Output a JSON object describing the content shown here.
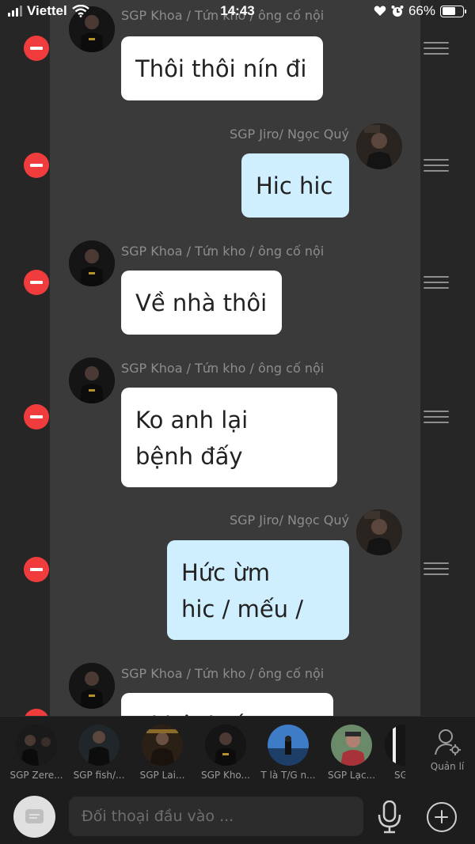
{
  "status_bar": {
    "carrier": "Viettel",
    "time": "14:43",
    "battery_percent": "66%",
    "battery_level": 0.66,
    "icons": [
      "signal-icon",
      "wifi-icon",
      "heart-icon",
      "alarm-icon",
      "battery-icon"
    ]
  },
  "messages": [
    {
      "sender": "SGP Khoa / Tứn kho / ông cố nội",
      "lines": [
        "Thôi thôi nín đi"
      ],
      "direction": "incoming"
    },
    {
      "sender": "SGP Jiro/ Ngọc Quý",
      "lines": [
        "Hic hic"
      ],
      "direction": "outgoing"
    },
    {
      "sender": "SGP Khoa / Tứn kho / ông cố nội",
      "lines": [
        "Về nhà thôi"
      ],
      "direction": "incoming"
    },
    {
      "sender": "SGP Khoa / Tứn kho / ông cố nội",
      "lines": [
        "Ko anh lại",
        "bệnh đấy"
      ],
      "direction": "incoming"
    },
    {
      "sender": "SGP Jiro/ Ngọc Quý",
      "lines": [
        "Hức ừm",
        "hic / mếu /"
      ],
      "direction": "outgoing"
    },
    {
      "sender": "SGP Khoa / Tứn kho / ông cố nội",
      "lines": [
        "Bị bệnh ấy"
      ],
      "direction": "incoming"
    }
  ],
  "contacts": [
    {
      "name": "SGP Zere..."
    },
    {
      "name": "SGP fish/..."
    },
    {
      "name": "SGP Lai..."
    },
    {
      "name": "SGP Kho..."
    },
    {
      "name": "T là T/G n..."
    },
    {
      "name": "SGP Lạc..."
    },
    {
      "name": "SG"
    }
  ],
  "manage_label": "Quản lí",
  "input": {
    "placeholder": "Đối thoại đầu vào ..."
  },
  "colors": {
    "delete": "#f03c3c",
    "incoming_bubble": "#ffffff",
    "outgoing_bubble": "#cfeefe",
    "background": "#3a3a3a"
  }
}
